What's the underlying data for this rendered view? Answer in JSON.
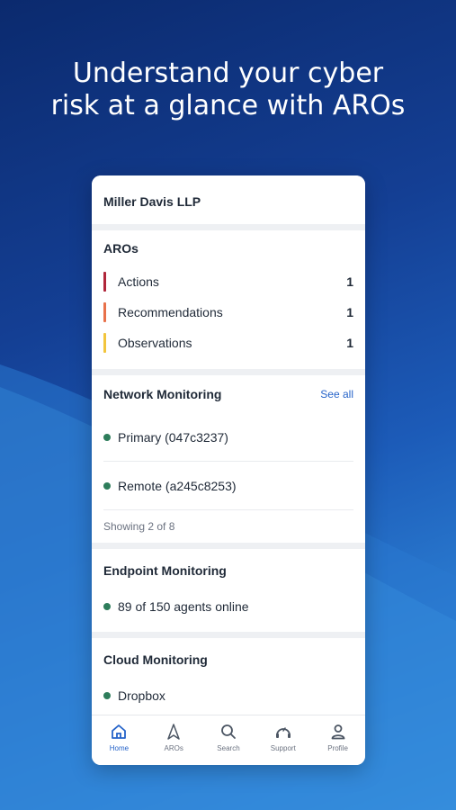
{
  "headline": {
    "line1": "Understand your cyber",
    "line2": "risk at a glance with AROs"
  },
  "company": "Miller Davis LLP",
  "aros": {
    "title": "AROs",
    "items": [
      {
        "label": "Actions",
        "count": "1",
        "color": "#b0263a"
      },
      {
        "label": "Recommendations",
        "count": "1",
        "color": "#e8714a"
      },
      {
        "label": "Observations",
        "count": "1",
        "color": "#f2c53d"
      }
    ]
  },
  "network": {
    "title": "Network Monitoring",
    "see_all": "See all",
    "items": [
      {
        "label": "Primary (047c3237)"
      },
      {
        "label": "Remote (a245c8253)"
      }
    ],
    "showing": "Showing 2 of 8"
  },
  "endpoint": {
    "title": "Endpoint Monitoring",
    "status": "89 of 150 agents online"
  },
  "cloud": {
    "title": "Cloud Monitoring",
    "items": [
      {
        "label": "Dropbox"
      }
    ]
  },
  "tabs": [
    {
      "label": "Home",
      "icon": "home-icon",
      "active": true
    },
    {
      "label": "AROs",
      "icon": "aros-icon",
      "active": false
    },
    {
      "label": "Search",
      "icon": "search-icon",
      "active": false
    },
    {
      "label": "Support",
      "icon": "support-icon",
      "active": false
    },
    {
      "label": "Profile",
      "icon": "profile-icon",
      "active": false
    }
  ],
  "colors": {
    "accent": "#2563c9",
    "status_online": "#2e7d5b",
    "background_top": "#0b2a6e",
    "background_bottom": "#3fa0e8"
  }
}
